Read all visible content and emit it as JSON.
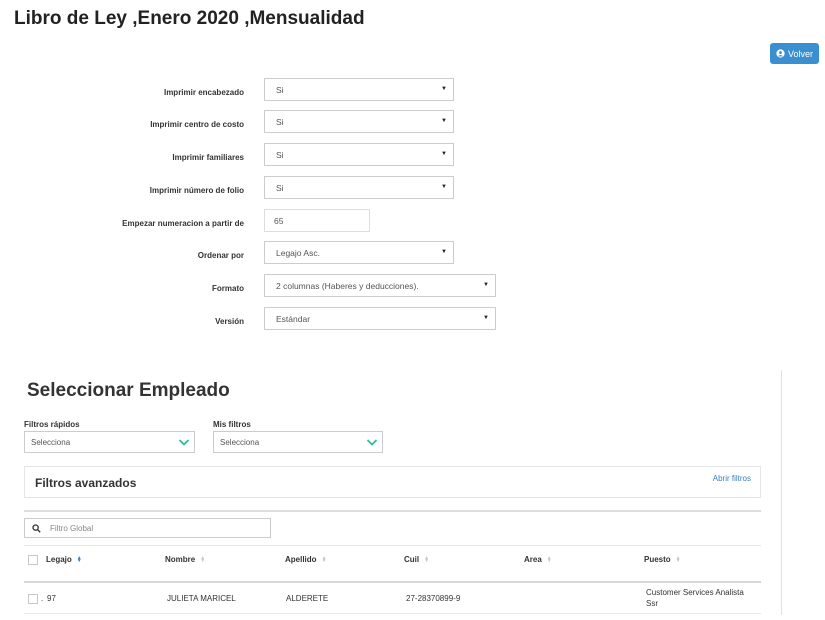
{
  "page": {
    "title": "Libro de Ley ,Enero 2020 ,Mensualidad"
  },
  "header": {
    "back_label": "Volver"
  },
  "form": {
    "print_header": {
      "label": "Imprimir encabezado",
      "value": "Si"
    },
    "print_cost_center": {
      "label": "Imprimir centro de costo",
      "value": "Si"
    },
    "print_family": {
      "label": "Imprimir familiares",
      "value": "Si"
    },
    "print_folio": {
      "label": "Imprimir número de folio",
      "value": "Si"
    },
    "start_number": {
      "label": "Empezar numeracion a partir de",
      "value": "65"
    },
    "order_by": {
      "label": "Ordenar por",
      "value": "Legajo Asc."
    },
    "format": {
      "label": "Formato",
      "value": "2 columnas (Haberes y deducciones)."
    },
    "version": {
      "label": "Versión",
      "value": "Estándar"
    }
  },
  "employees": {
    "title": "Seleccionar Empleado",
    "quick_filters": {
      "label": "Filtros rápidos",
      "value": "Selecciona"
    },
    "my_filters": {
      "label": "Mis filtros",
      "value": "Selecciona"
    },
    "advanced": {
      "title": "Filtros avanzados",
      "open_link": "Abrir filtros"
    },
    "search": {
      "placeholder": "Filtro Global"
    },
    "columns": {
      "legajo": "Legajo",
      "nombre": "Nombre",
      "apellido": "Apellido",
      "cuil": "Cuil",
      "area": "Area",
      "puesto": "Puesto"
    },
    "rows": [
      {
        "legajo": "97",
        "nombre": "JULIETA MARICEL",
        "apellido": "ALDERETE",
        "cuil": "27-28370899-9",
        "area": "",
        "puesto_line1": "Customer Services Analista",
        "puesto_line2": "Ssr"
      }
    ]
  },
  "colors": {
    "accent": "#3a8fd0",
    "link": "#3a7fc0",
    "chevron": "#2bbf9a"
  }
}
